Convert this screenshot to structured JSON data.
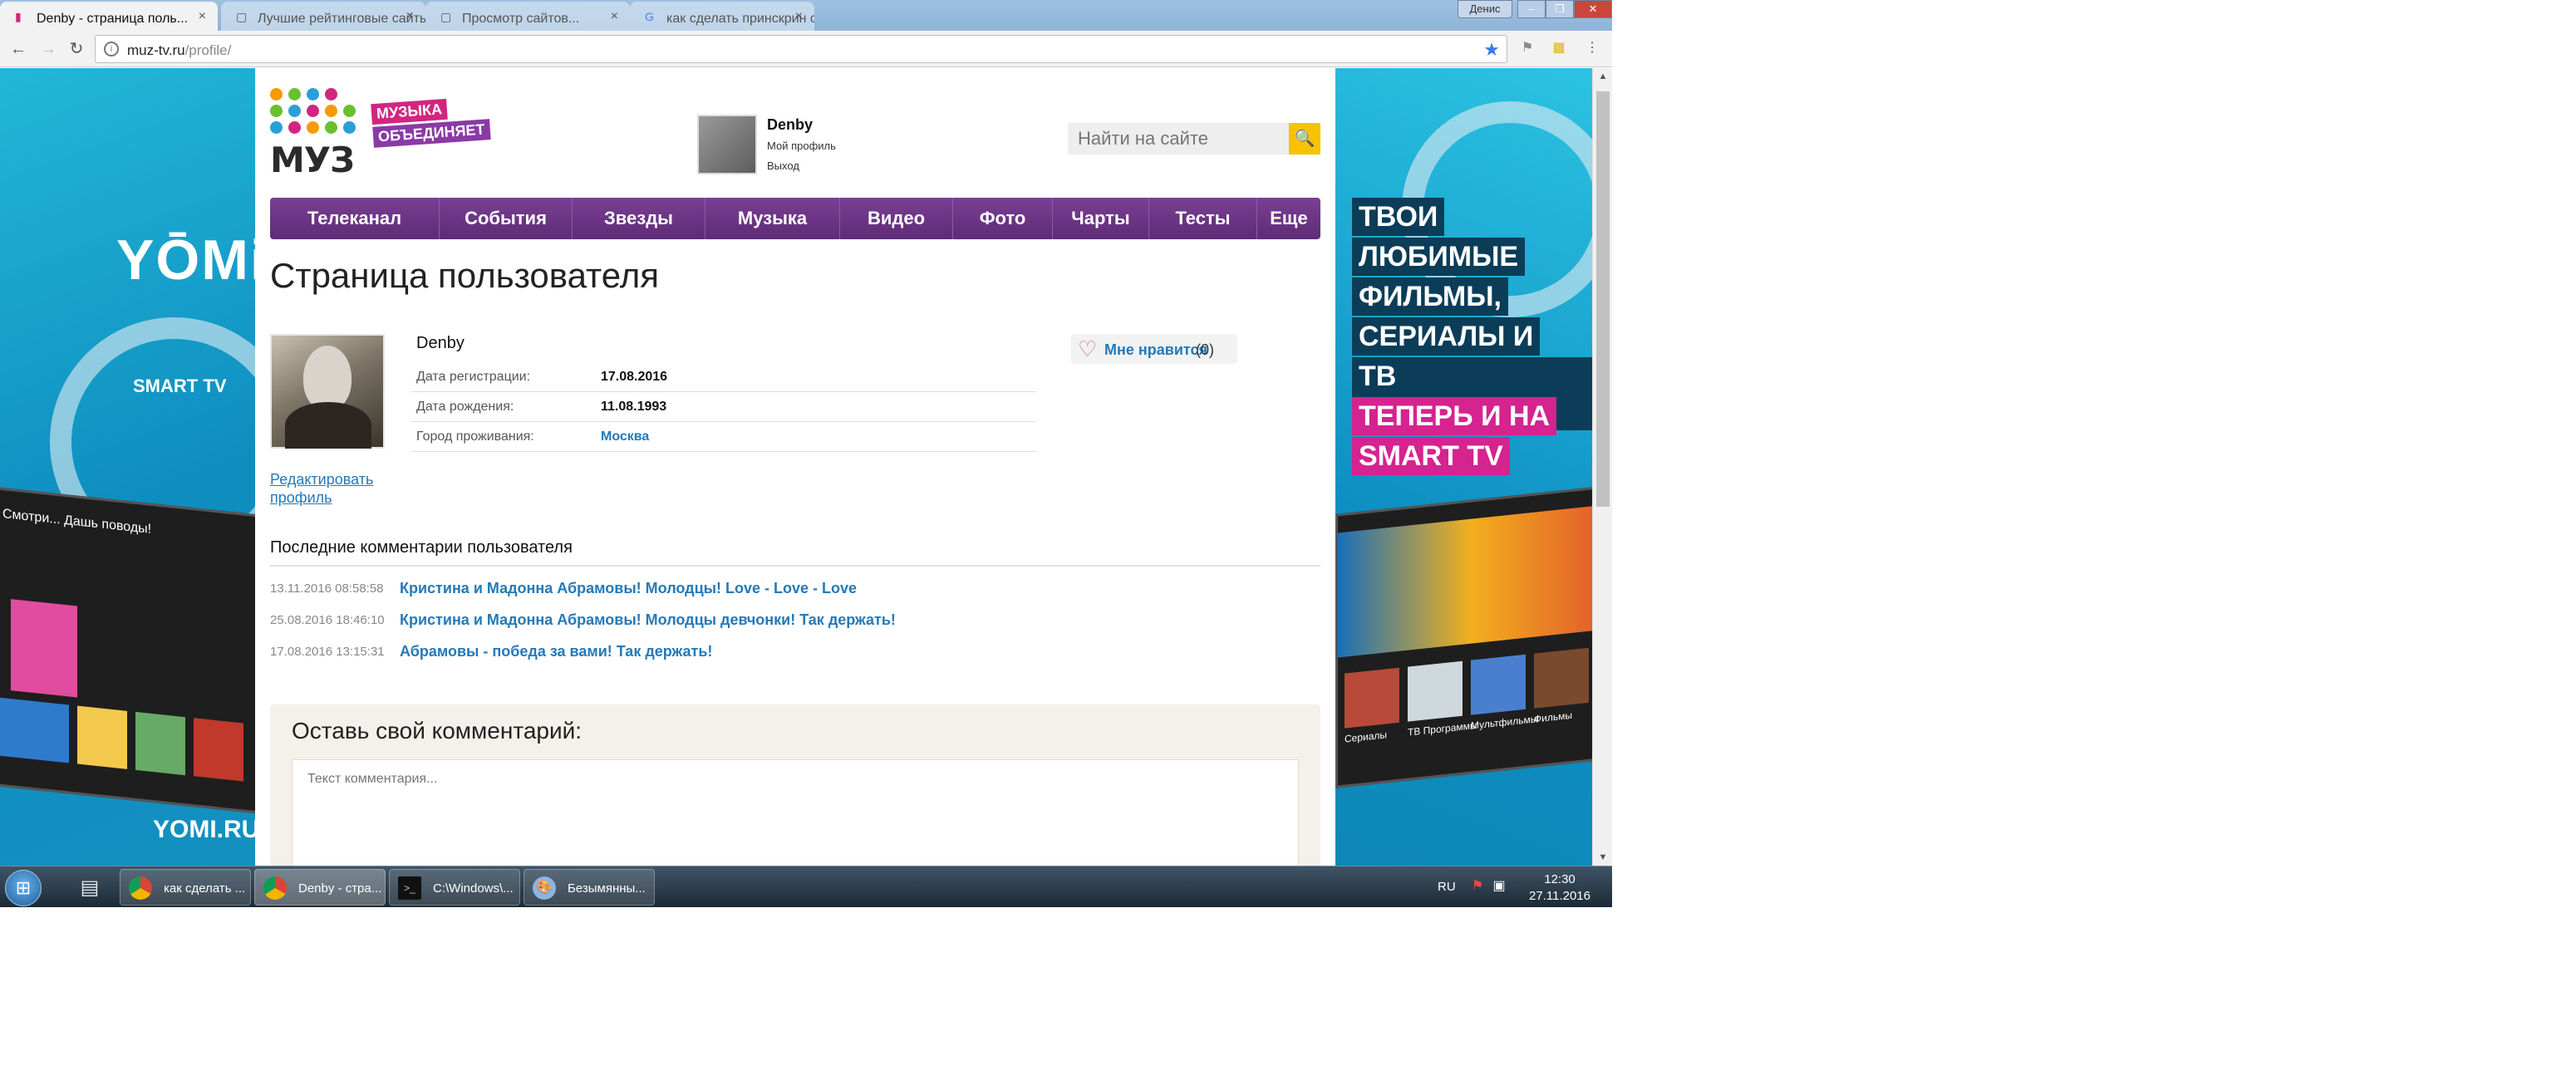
{
  "browser": {
    "tabs": [
      {
        "title": "Denby - страница поль...",
        "active": true
      },
      {
        "title": "Лучшие рейтинговые сайты...",
        "active": false
      },
      {
        "title": "Просмотр сайтов...",
        "active": false
      },
      {
        "title": "как сделать принскрин с...",
        "active": false
      }
    ],
    "profile_label": "Денис",
    "url_host": "muz-tv.ru",
    "url_path": "/profile/"
  },
  "site": {
    "logo_text": "МУЗ",
    "tagline_line1": "МУЗЫКА",
    "tagline_line2": "ОБЪЕДИНЯЕТ",
    "user": {
      "name": "Denby",
      "my_profile": "Мой профиль",
      "logout": "Выход"
    },
    "search_placeholder": "Найти на сайте",
    "menu": [
      "Телеканал",
      "События",
      "Звезды",
      "Музыка",
      "Видео",
      "Фото",
      "Чарты",
      "Тесты",
      "Еще"
    ],
    "page_title": "Страница пользователя",
    "profile": {
      "name": "Denby",
      "edit_line1": "Редактировать",
      "edit_line2": "профиль",
      "rows": [
        {
          "label": "Дата регистрации:",
          "value": "17.08.2016"
        },
        {
          "label": "Дата рождения:",
          "value": "11.08.1993"
        },
        {
          "label": "Город проживания:",
          "value": "Москва"
        }
      ],
      "like_label": "Мне нравится",
      "like_count": "(0)"
    },
    "comments_heading": "Последние комментарии пользователя",
    "comments": [
      {
        "date": "13.11.2016 08:58:58",
        "text": "Кристина и Мадонна Абрамовы! Молодцы! Love - Love - Love"
      },
      {
        "date": "25.08.2016 18:46:10",
        "text": "Кристина и Мадонна Абрамовы! Молодцы девчонки! Так держать!"
      },
      {
        "date": "17.08.2016 13:15:31",
        "text": "Абрамовы - победа за вами! Так держать!"
      }
    ],
    "form_title": "Оставь свой комментарий:",
    "form_placeholder": "Текст комментария..."
  },
  "ads": {
    "left_brand": "YŌMi",
    "left_smarttv": "SMART TV",
    "left_url": "YOMI.RU",
    "left_screen_text": "Смотри... Дашь поводы!",
    "right_slogan": [
      "ТВОИ",
      "ЛЮБИМЫЕ",
      "ФИЛЬМЫ,",
      "СЕРИАЛЫ И",
      "ТВ ПРОГРАММЫ",
      "ТЕПЕРЬ И НА",
      "SMART TV"
    ],
    "right_screen_labels": [
      "Сериалы",
      "ТВ Программы",
      "Мультфильмы",
      "Фильмы"
    ]
  },
  "taskbar": {
    "tasks": [
      {
        "title": "как сделать ...",
        "active": false
      },
      {
        "title": "Denby - стра...",
        "active": true
      },
      {
        "title": "C:\\Windows\\...",
        "active": false
      },
      {
        "title": "Безымянны...",
        "active": false
      }
    ],
    "lang": "RU",
    "time": "12:30",
    "date": "27.11.2016"
  },
  "colors": {
    "brand_purple": "#6a3384",
    "link_blue": "#2479b8",
    "search_yellow": "#f7c300",
    "tag_pink": "#d12680"
  }
}
